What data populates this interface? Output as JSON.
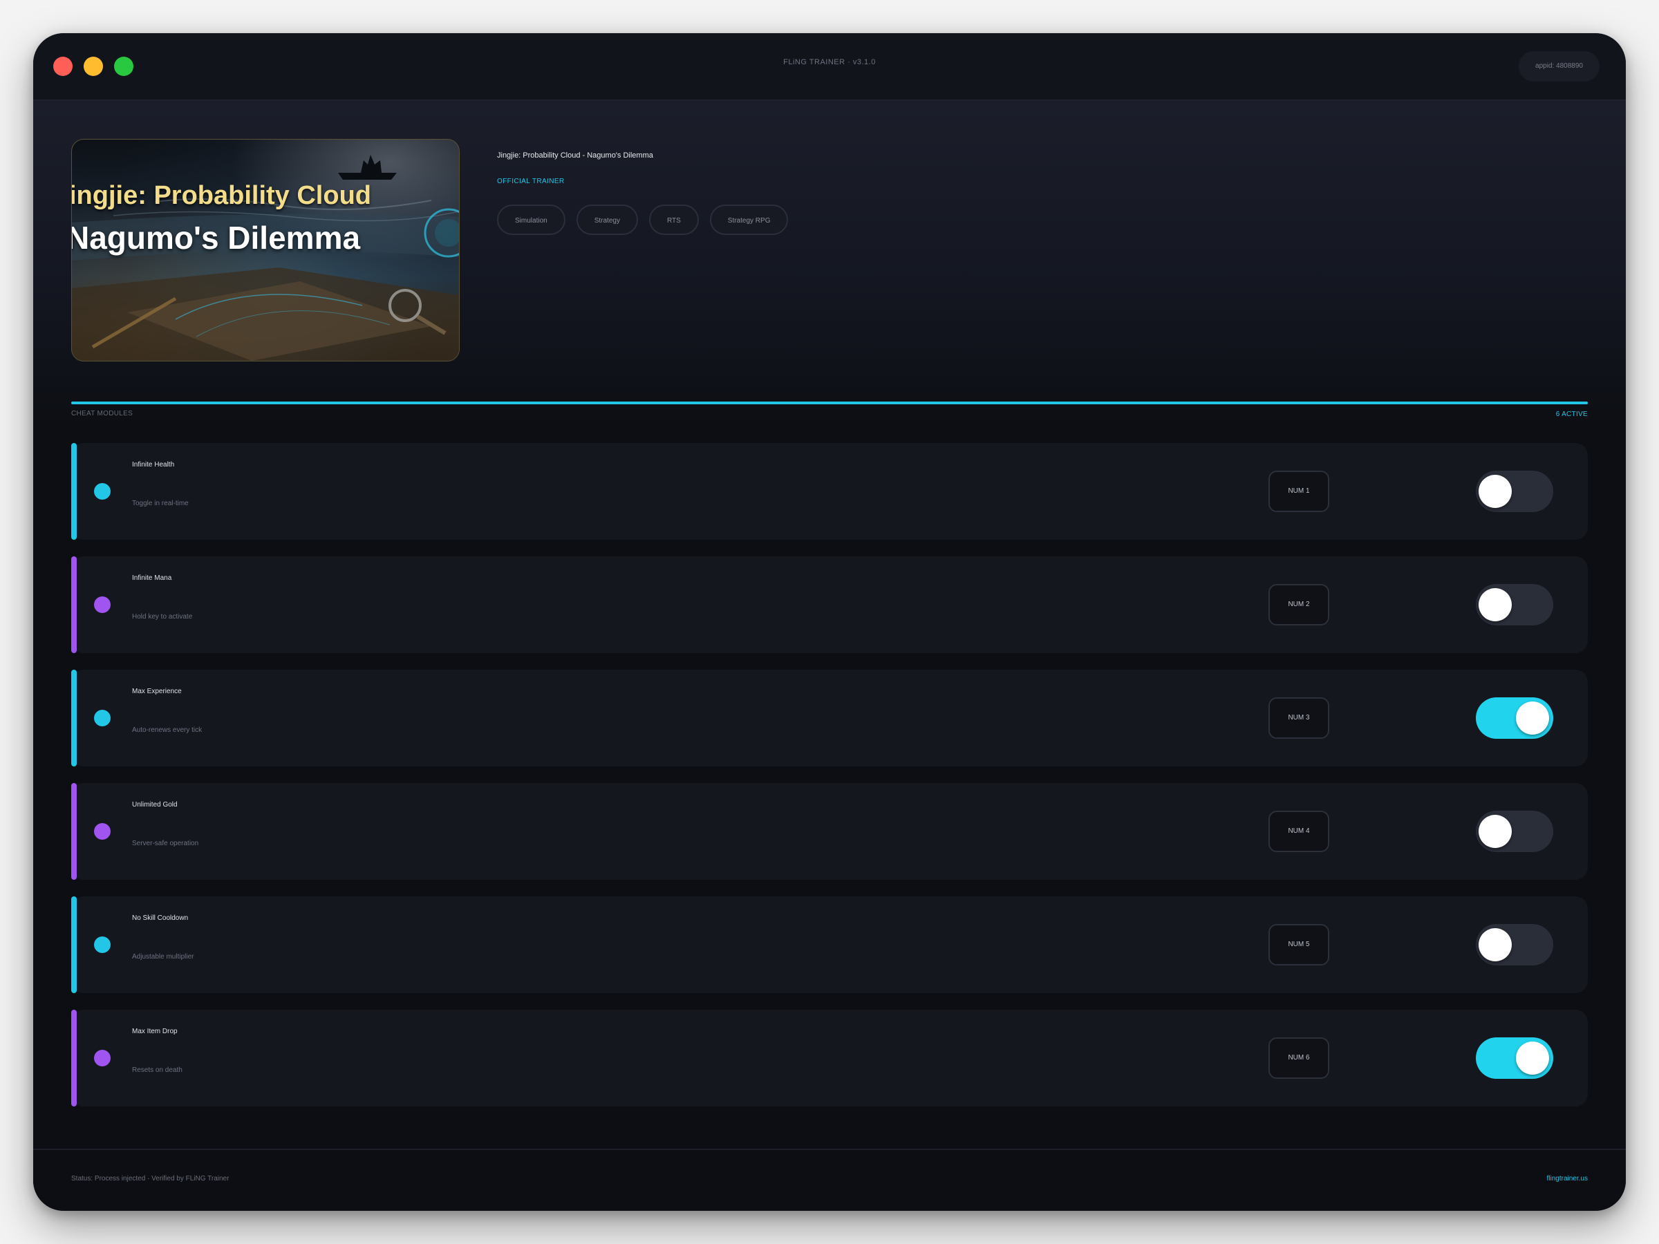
{
  "window": {
    "title": "FLiNG TRAINER · v3.1.0",
    "appid": "appid: 4808890"
  },
  "game": {
    "title": "Jingjie: Probability Cloud - Nagumo's Dilemma",
    "cover_line1": "ingjie: Probability Cloud",
    "cover_line2": "Nagumo's Dilemma",
    "badge": "OFFICIAL TRAINER",
    "tags": [
      "Simulation",
      "Strategy",
      "RTS",
      "Strategy RPG"
    ]
  },
  "modules_header": {
    "label": "CHEAT MODULES",
    "active": "6 ACTIVE"
  },
  "modules": [
    {
      "name": "Infinite Health",
      "desc": "Toggle in real-time",
      "hotkey": "NUM 1",
      "accent": "#22c6e6",
      "enabled": false
    },
    {
      "name": "Infinite Mana",
      "desc": "Hold key to activate",
      "hotkey": "NUM 2",
      "accent": "#a155f0",
      "enabled": false
    },
    {
      "name": "Max Experience",
      "desc": "Auto-renews every tick",
      "hotkey": "NUM 3",
      "accent": "#22c6e6",
      "enabled": true
    },
    {
      "name": "Unlimited Gold",
      "desc": "Server-safe operation",
      "hotkey": "NUM 4",
      "accent": "#a155f0",
      "enabled": false
    },
    {
      "name": "No Skill Cooldown",
      "desc": "Adjustable multiplier",
      "hotkey": "NUM 5",
      "accent": "#22c6e6",
      "enabled": false
    },
    {
      "name": "Max Item Drop",
      "desc": "Resets on death",
      "hotkey": "NUM 6",
      "accent": "#a155f0",
      "enabled": true
    }
  ],
  "footer": {
    "status": "Status: Process injected · Verified by FLiNG Trainer",
    "link": "flingtrainer.us"
  },
  "colors": {
    "accent_cyan": "#22c6e6",
    "accent_purple": "#a155f0",
    "toggle_on": "#22d3ee",
    "background": "#0c0e13"
  },
  "icons": [
    "close-dot-icon",
    "minimize-dot-icon",
    "zoom-dot-icon",
    "status-dot-icon"
  ]
}
